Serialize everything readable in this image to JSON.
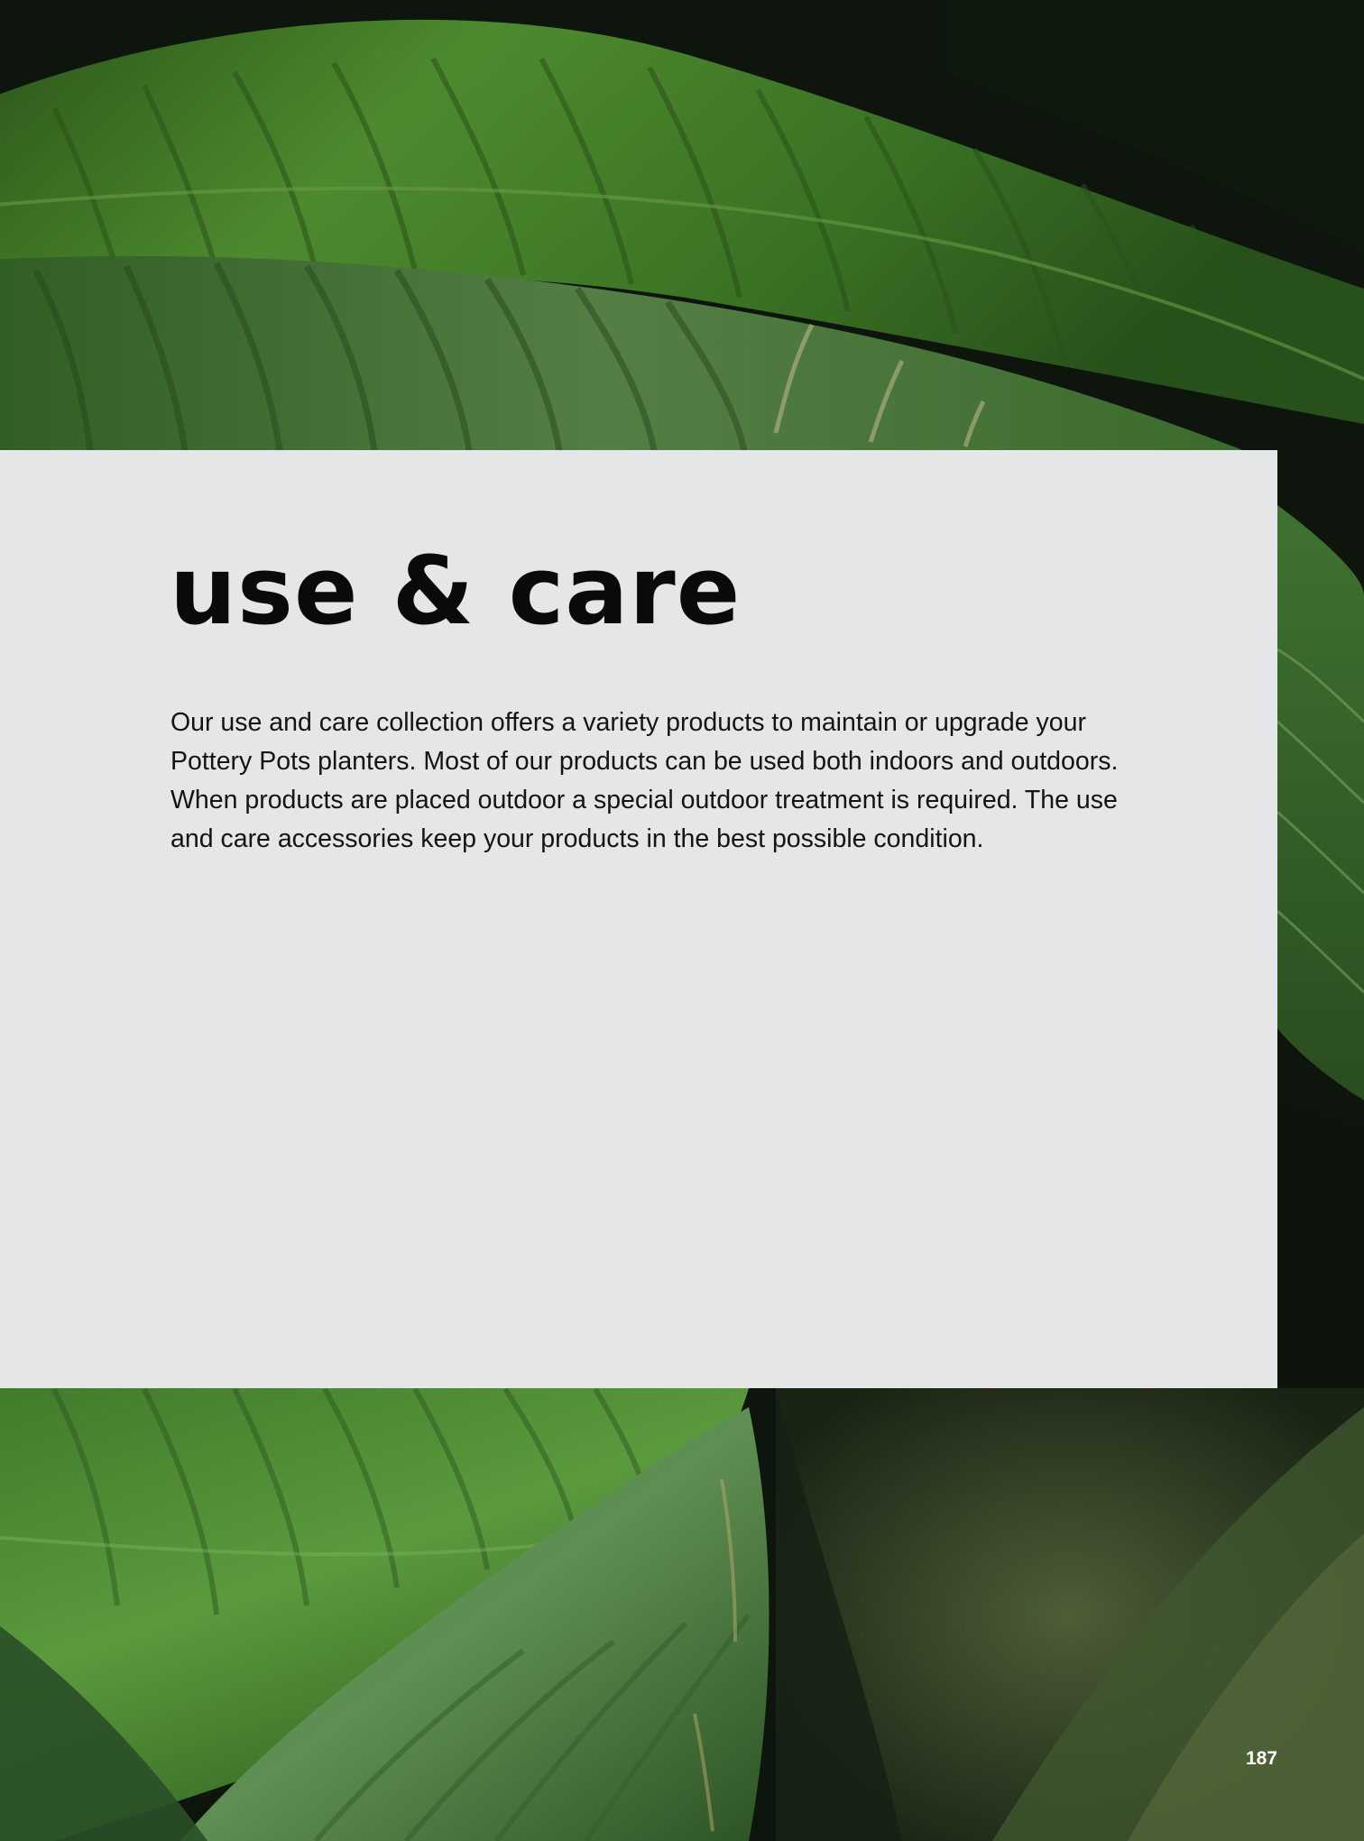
{
  "page": {
    "title": "use & care",
    "body": "Our use and care collection offers a variety products to maintain or upgrade your Pottery Pots planters. Most of our products can be used both indoors and outdoors. When products are placed outdoor a special outdoor treatment is required. The use and care accessories keep your products in the best possible condition.",
    "page_number": "187"
  },
  "background": {
    "subject": "green leaves photo",
    "colors": {
      "panel": "#e5e6e8",
      "leaf_dark": "#1f3a16",
      "leaf_mid": "#3f7a2a",
      "leaf_light": "#6aa04a",
      "shadow": "#0b120b"
    }
  }
}
